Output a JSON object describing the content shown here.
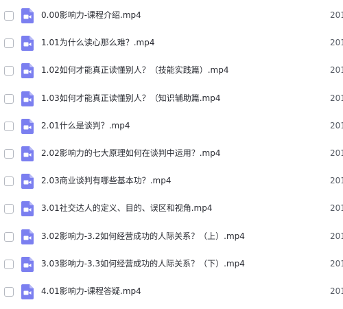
{
  "files": [
    {
      "name": "0.00影响力-课程介绍.mp4",
      "date": "201"
    },
    {
      "name": "1.01为什么读心那么难？.mp4",
      "date": "201"
    },
    {
      "name": "1.02如何才能真正读懂别人？（技能实践篇）.mp4",
      "date": "201"
    },
    {
      "name": "1.03如何才能真正读懂别人？（知识辅助篇.mp4",
      "date": "201"
    },
    {
      "name": "2.01什么是谈判？.mp4",
      "date": "201"
    },
    {
      "name": "2.02影响力的七大原理如何在谈判中运用？.mp4",
      "date": "201"
    },
    {
      "name": "2.03商业谈判有哪些基本功？.mp4",
      "date": "201"
    },
    {
      "name": "3.01社交达人的定义、目的、误区和视角.mp4",
      "date": "201"
    },
    {
      "name": "3.02影响力-3.2如何经营成功的人际关系？（上）.mp4",
      "date": "201"
    },
    {
      "name": "3.03影响力-3.3如何经营成功的人际关系？（下）.mp4",
      "date": "201"
    },
    {
      "name": "4.01影响力-课程答疑.mp4",
      "date": "201"
    }
  ],
  "icon": {
    "name": "video-file-icon",
    "color": "#7b7ff0"
  }
}
